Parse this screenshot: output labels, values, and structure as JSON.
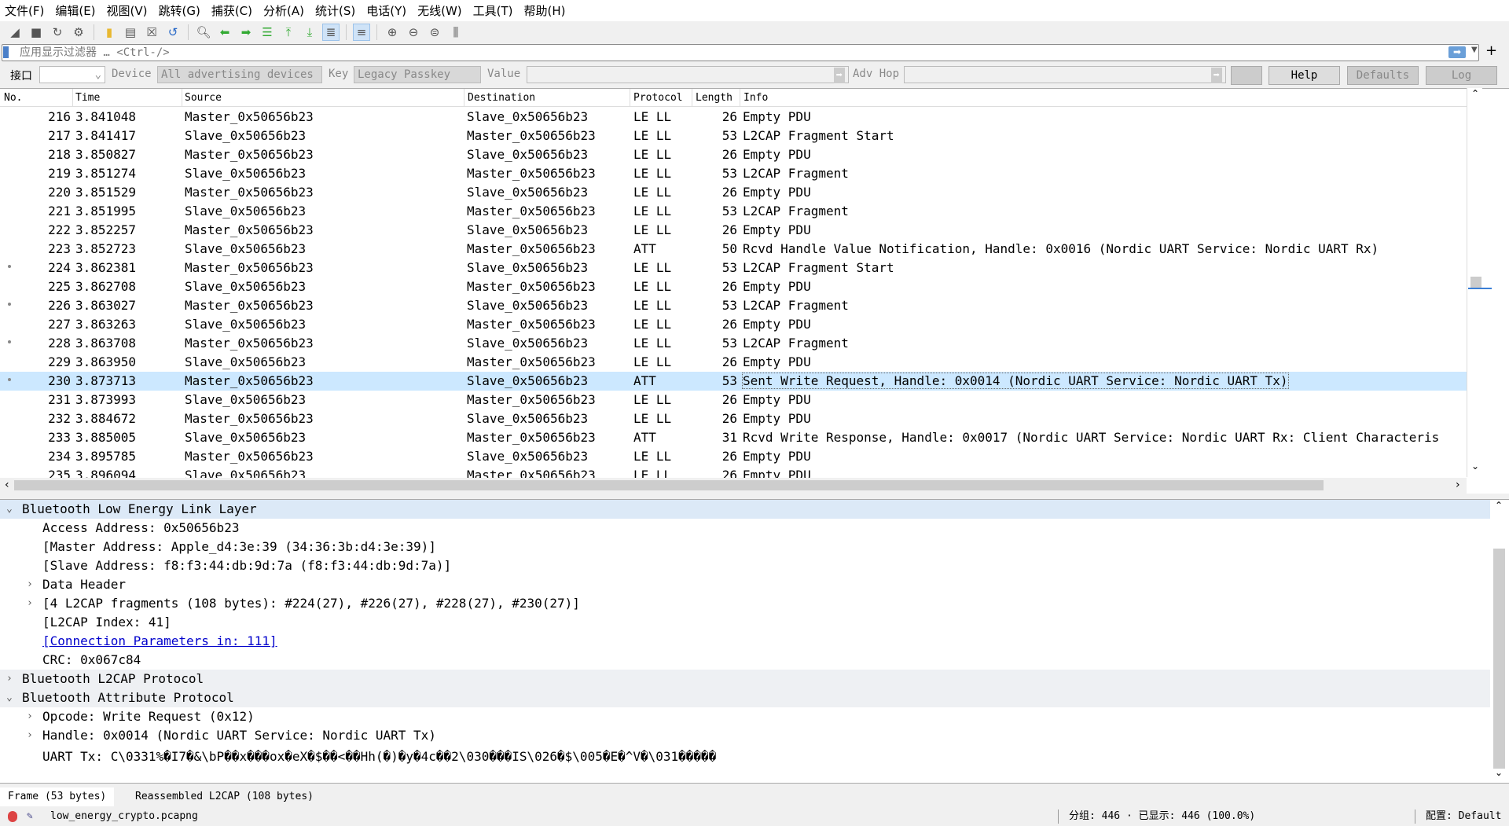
{
  "menu": [
    "文件(F)",
    "编辑(E)",
    "视图(V)",
    "跳转(G)",
    "捕获(C)",
    "分析(A)",
    "统计(S)",
    "电话(Y)",
    "无线(W)",
    "工具(T)",
    "帮助(H)"
  ],
  "filter": {
    "placeholder": "应用显示过滤器 … <Ctrl-/>"
  },
  "wireless": {
    "iface_label": "接口",
    "iface_value": "",
    "device_label": "Device",
    "device_value": "All advertising devices",
    "key_label": "Key",
    "key_value": "Legacy Passkey",
    "value_label": "Value",
    "value_value": "",
    "adv_hop_label": "Adv Hop",
    "help": "Help",
    "defaults": "Defaults",
    "log": "Log"
  },
  "columns": {
    "no": "No.",
    "time": "Time",
    "source": "Source",
    "destination": "Destination",
    "protocol": "Protocol",
    "length": "Length",
    "info": "Info"
  },
  "packets": [
    {
      "no": "216",
      "time": "3.841048",
      "src": "Master_0x50656b23",
      "dst": "Slave_0x50656b23",
      "proto": "LE LL",
      "len": "26",
      "info": "Empty PDU"
    },
    {
      "no": "217",
      "time": "3.841417",
      "src": "Slave_0x50656b23",
      "dst": "Master_0x50656b23",
      "proto": "LE LL",
      "len": "53",
      "info": "L2CAP Fragment Start"
    },
    {
      "no": "218",
      "time": "3.850827",
      "src": "Master_0x50656b23",
      "dst": "Slave_0x50656b23",
      "proto": "LE LL",
      "len": "26",
      "info": "Empty PDU"
    },
    {
      "no": "219",
      "time": "3.851274",
      "src": "Slave_0x50656b23",
      "dst": "Master_0x50656b23",
      "proto": "LE LL",
      "len": "53",
      "info": "L2CAP Fragment"
    },
    {
      "no": "220",
      "time": "3.851529",
      "src": "Master_0x50656b23",
      "dst": "Slave_0x50656b23",
      "proto": "LE LL",
      "len": "26",
      "info": "Empty PDU"
    },
    {
      "no": "221",
      "time": "3.851995",
      "src": "Slave_0x50656b23",
      "dst": "Master_0x50656b23",
      "proto": "LE LL",
      "len": "53",
      "info": "L2CAP Fragment"
    },
    {
      "no": "222",
      "time": "3.852257",
      "src": "Master_0x50656b23",
      "dst": "Slave_0x50656b23",
      "proto": "LE LL",
      "len": "26",
      "info": "Empty PDU"
    },
    {
      "no": "223",
      "time": "3.852723",
      "src": "Slave_0x50656b23",
      "dst": "Master_0x50656b23",
      "proto": "ATT",
      "len": "50",
      "info": "Rcvd Handle Value Notification, Handle: 0x0016 (Nordic UART Service: Nordic UART Rx)"
    },
    {
      "no": "224",
      "time": "3.862381",
      "src": "Master_0x50656b23",
      "dst": "Slave_0x50656b23",
      "proto": "LE LL",
      "len": "53",
      "info": "L2CAP Fragment Start",
      "dot": true
    },
    {
      "no": "225",
      "time": "3.862708",
      "src": "Slave_0x50656b23",
      "dst": "Master_0x50656b23",
      "proto": "LE LL",
      "len": "26",
      "info": "Empty PDU"
    },
    {
      "no": "226",
      "time": "3.863027",
      "src": "Master_0x50656b23",
      "dst": "Slave_0x50656b23",
      "proto": "LE LL",
      "len": "53",
      "info": "L2CAP Fragment",
      "dot": true
    },
    {
      "no": "227",
      "time": "3.863263",
      "src": "Slave_0x50656b23",
      "dst": "Master_0x50656b23",
      "proto": "LE LL",
      "len": "26",
      "info": "Empty PDU"
    },
    {
      "no": "228",
      "time": "3.863708",
      "src": "Master_0x50656b23",
      "dst": "Slave_0x50656b23",
      "proto": "LE LL",
      "len": "53",
      "info": "L2CAP Fragment",
      "dot": true
    },
    {
      "no": "229",
      "time": "3.863950",
      "src": "Slave_0x50656b23",
      "dst": "Master_0x50656b23",
      "proto": "LE LL",
      "len": "26",
      "info": "Empty PDU"
    },
    {
      "no": "230",
      "time": "3.873713",
      "src": "Master_0x50656b23",
      "dst": "Slave_0x50656b23",
      "proto": "ATT",
      "len": "53",
      "info": "Sent Write Request, Handle: 0x0014 (Nordic UART Service: Nordic UART Tx)",
      "dot": true,
      "selected": true
    },
    {
      "no": "231",
      "time": "3.873993",
      "src": "Slave_0x50656b23",
      "dst": "Master_0x50656b23",
      "proto": "LE LL",
      "len": "26",
      "info": "Empty PDU"
    },
    {
      "no": "232",
      "time": "3.884672",
      "src": "Master_0x50656b23",
      "dst": "Slave_0x50656b23",
      "proto": "LE LL",
      "len": "26",
      "info": "Empty PDU"
    },
    {
      "no": "233",
      "time": "3.885005",
      "src": "Slave_0x50656b23",
      "dst": "Master_0x50656b23",
      "proto": "ATT",
      "len": "31",
      "info": "Rcvd Write Response, Handle: 0x0017 (Nordic UART Service: Nordic UART Rx: Client Characteris"
    },
    {
      "no": "234",
      "time": "3.895785",
      "src": "Master_0x50656b23",
      "dst": "Slave_0x50656b23",
      "proto": "LE LL",
      "len": "26",
      "info": "Empty PDU"
    },
    {
      "no": "235",
      "time": "3.896094",
      "src": "Slave_0x50656b23",
      "dst": "Master_0x50656b23",
      "proto": "LE LL",
      "len": "26",
      "info": "Empty PDU"
    }
  ],
  "details": [
    {
      "text": "Bluetooth Low Energy Link Layer",
      "level": 0,
      "arrow": "open",
      "style": "hl"
    },
    {
      "text": "Access Address: 0x50656b23",
      "level": 1
    },
    {
      "text": "[Master Address: Apple_d4:3e:39 (34:36:3b:d4:3e:39)]",
      "level": 1
    },
    {
      "text": "[Slave Address: f8:f3:44:db:9d:7a (f8:f3:44:db:9d:7a)]",
      "level": 1
    },
    {
      "text": "Data Header",
      "level": 1,
      "arrow": "closed"
    },
    {
      "text": "[4 L2CAP fragments (108 bytes): #224(27), #226(27), #228(27), #230(27)]",
      "level": 1,
      "arrow": "closed"
    },
    {
      "text": "[L2CAP Index: 41]",
      "level": 1
    },
    {
      "text": "[Connection Parameters in: 111]",
      "level": 1,
      "link": true
    },
    {
      "text": "CRC: 0x067c84",
      "level": 1
    },
    {
      "text": "Bluetooth L2CAP Protocol",
      "level": 0,
      "arrow": "closed",
      "style": "top"
    },
    {
      "text": "Bluetooth Attribute Protocol",
      "level": 0,
      "arrow": "open",
      "style": "top"
    },
    {
      "text": "Opcode: Write Request (0x12)",
      "level": 1,
      "arrow": "closed"
    },
    {
      "text": "Handle: 0x0014 (Nordic UART Service: Nordic UART Tx)",
      "level": 1,
      "arrow": "closed"
    },
    {
      "text": "UART Tx: C\\0331%�I7�&\\bP��x���ox�eX�$��<��Hh(�)�y�4c��2\\030���IS\\026�$\\005�E�^V�\\031�����",
      "level": 1
    }
  ],
  "byte_tabs": [
    "Frame (53 bytes)",
    "Reassembled L2CAP (108 bytes)"
  ],
  "status": {
    "file": "low_energy_crypto.pcapng",
    "packets": "分组: 446 · 已显示: 446 (100.0%)",
    "profile": "配置: Default"
  }
}
